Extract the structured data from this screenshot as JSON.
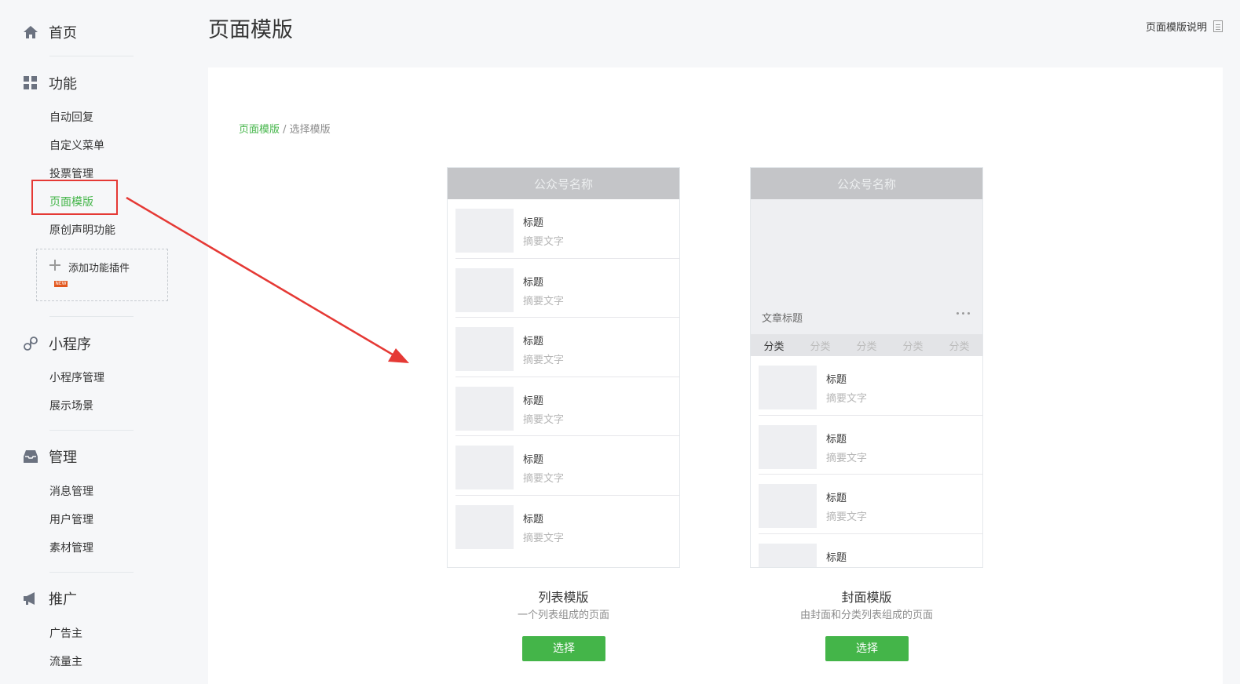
{
  "sidebar": {
    "home": {
      "label": "首页",
      "icon": "home-icon"
    },
    "function": {
      "label": "功能",
      "icon": "grid-icon",
      "items": [
        "自动回复",
        "自定义菜单",
        "投票管理",
        "页面模版",
        "原创声明功能"
      ],
      "active_item": "页面模版",
      "add_plugin": {
        "label": "添加功能插件",
        "badge": "NEW"
      }
    },
    "miniprogram": {
      "label": "小程序",
      "icon": "link-icon",
      "items": [
        "小程序管理",
        "展示场景"
      ]
    },
    "manage": {
      "label": "管理",
      "icon": "inbox-icon",
      "items": [
        "消息管理",
        "用户管理",
        "素材管理"
      ]
    },
    "promote": {
      "label": "推广",
      "icon": "megaphone-icon",
      "items": [
        "广告主",
        "流量主"
      ]
    }
  },
  "header": {
    "title": "页面模版",
    "help_link": "页面模版说明"
  },
  "breadcrumb": {
    "link": "页面模版",
    "separator": " / ",
    "current": "选择模版"
  },
  "templates": [
    {
      "bar_title": "公众号名称",
      "rows": [
        {
          "title": "标题",
          "summary": "摘要文字"
        },
        {
          "title": "标题",
          "summary": "摘要文字"
        },
        {
          "title": "标题",
          "summary": "摘要文字"
        },
        {
          "title": "标题",
          "summary": "摘要文字"
        },
        {
          "title": "标题",
          "summary": "摘要文字"
        },
        {
          "title": "标题",
          "summary": "摘要文字"
        }
      ],
      "name": "列表模版",
      "desc": "一个列表组成的页面",
      "button": "选择"
    },
    {
      "bar_title": "公众号名称",
      "cover_title": "文章标题",
      "categories": [
        "分类",
        "分类",
        "分类",
        "分类",
        "分类"
      ],
      "rows": [
        {
          "title": "标题",
          "summary": "摘要文字"
        },
        {
          "title": "标题",
          "summary": "摘要文字"
        },
        {
          "title": "标题",
          "summary": "摘要文字"
        },
        {
          "title": "标题",
          "summary": ""
        }
      ],
      "name": "封面模版",
      "desc": "由封面和分类列表组成的页面",
      "button": "选择"
    }
  ],
  "colors": {
    "accent": "#44b549",
    "annotation": "#e53935"
  }
}
